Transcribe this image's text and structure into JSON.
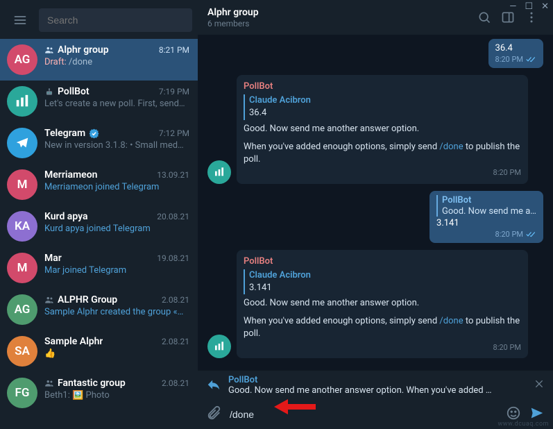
{
  "window_controls": {
    "min": "—",
    "max": "☐",
    "close": "✕"
  },
  "search": {
    "placeholder": "Search"
  },
  "chat_header": {
    "title": "Alphr group",
    "subtitle": "6 members"
  },
  "chats": [
    {
      "name": "Alphr group",
      "time": "8:21 PM",
      "draft_label": "Draft: ",
      "draft_value": "/done",
      "avatar": "AG",
      "color": "#d24a6b",
      "type": "group",
      "active": true
    },
    {
      "name": "PollBot",
      "time": "7:19 PM",
      "sub": "Let's create a new poll. First, send…",
      "avatar": "bot",
      "color": "#2aa89a",
      "type": "bot"
    },
    {
      "name": "Telegram",
      "time": "7:12 PM",
      "sub": "New in version 3.1.8:  • Small med…",
      "verified": true,
      "color": "#2fa1de",
      "type": "channel"
    },
    {
      "name": "Merriameon",
      "time": "13.09.21",
      "sub": "Merriameon joined Telegram",
      "sub_link": true,
      "avatar": "M",
      "color": "#d24a6b"
    },
    {
      "name": "Kurd apya",
      "time": "20.08.21",
      "sub": "Kurd apya joined Telegram",
      "sub_link": true,
      "avatar": "KA",
      "color": "#8d6fd1"
    },
    {
      "name": "Mar",
      "time": "19.08.21",
      "sub": "Mar joined Telegram",
      "sub_link": true,
      "avatar": "M",
      "color": "#d24a6b"
    },
    {
      "name": "ALPHR Group",
      "time": "2.08.21",
      "sub": "Sample Alphr created the group «…",
      "sub_link": true,
      "avatar": "AG",
      "color": "#4f9c6f",
      "type": "group"
    },
    {
      "name": "Sample Alphr",
      "time": "2.08.21",
      "sub": "👍",
      "avatar": "SA",
      "color": "#e0813c"
    },
    {
      "name": "Fantastic group",
      "time": "2.08.21",
      "sub": "Beth1: 🖼️ Photo",
      "avatar": "FG",
      "color": "#4f9c6f",
      "type": "group"
    }
  ],
  "messages": {
    "out1": {
      "text": "36.4",
      "time": "8:20 PM"
    },
    "in1": {
      "bot": "PollBot",
      "quote_name": "Claude Acibron",
      "quote_text": "36.4",
      "line1": "Good. Now send me another answer option.",
      "line2a": "When you've added enough options, simply send ",
      "cmd": "/done",
      "line2b": " to publish the poll.",
      "time": "8:20 PM"
    },
    "out2": {
      "reply_name": "PollBot",
      "reply_text": "Good. Now send me a…",
      "text": "3.141",
      "time": "8:20 PM"
    },
    "in2": {
      "bot": "PollBot",
      "quote_name": "Claude Acibron",
      "quote_text": "3.141",
      "line1": "Good. Now send me another answer option.",
      "line2a": "When you've added enough options, simply send ",
      "cmd": "/done",
      "line2b": " to publish the poll.",
      "time": "8:20 PM"
    }
  },
  "reply_bar": {
    "name": "PollBot",
    "text": "Good. Now send me another answer option.  When you've added …"
  },
  "compose": {
    "value": "/done"
  },
  "watermark": "www.dcuaq.com"
}
